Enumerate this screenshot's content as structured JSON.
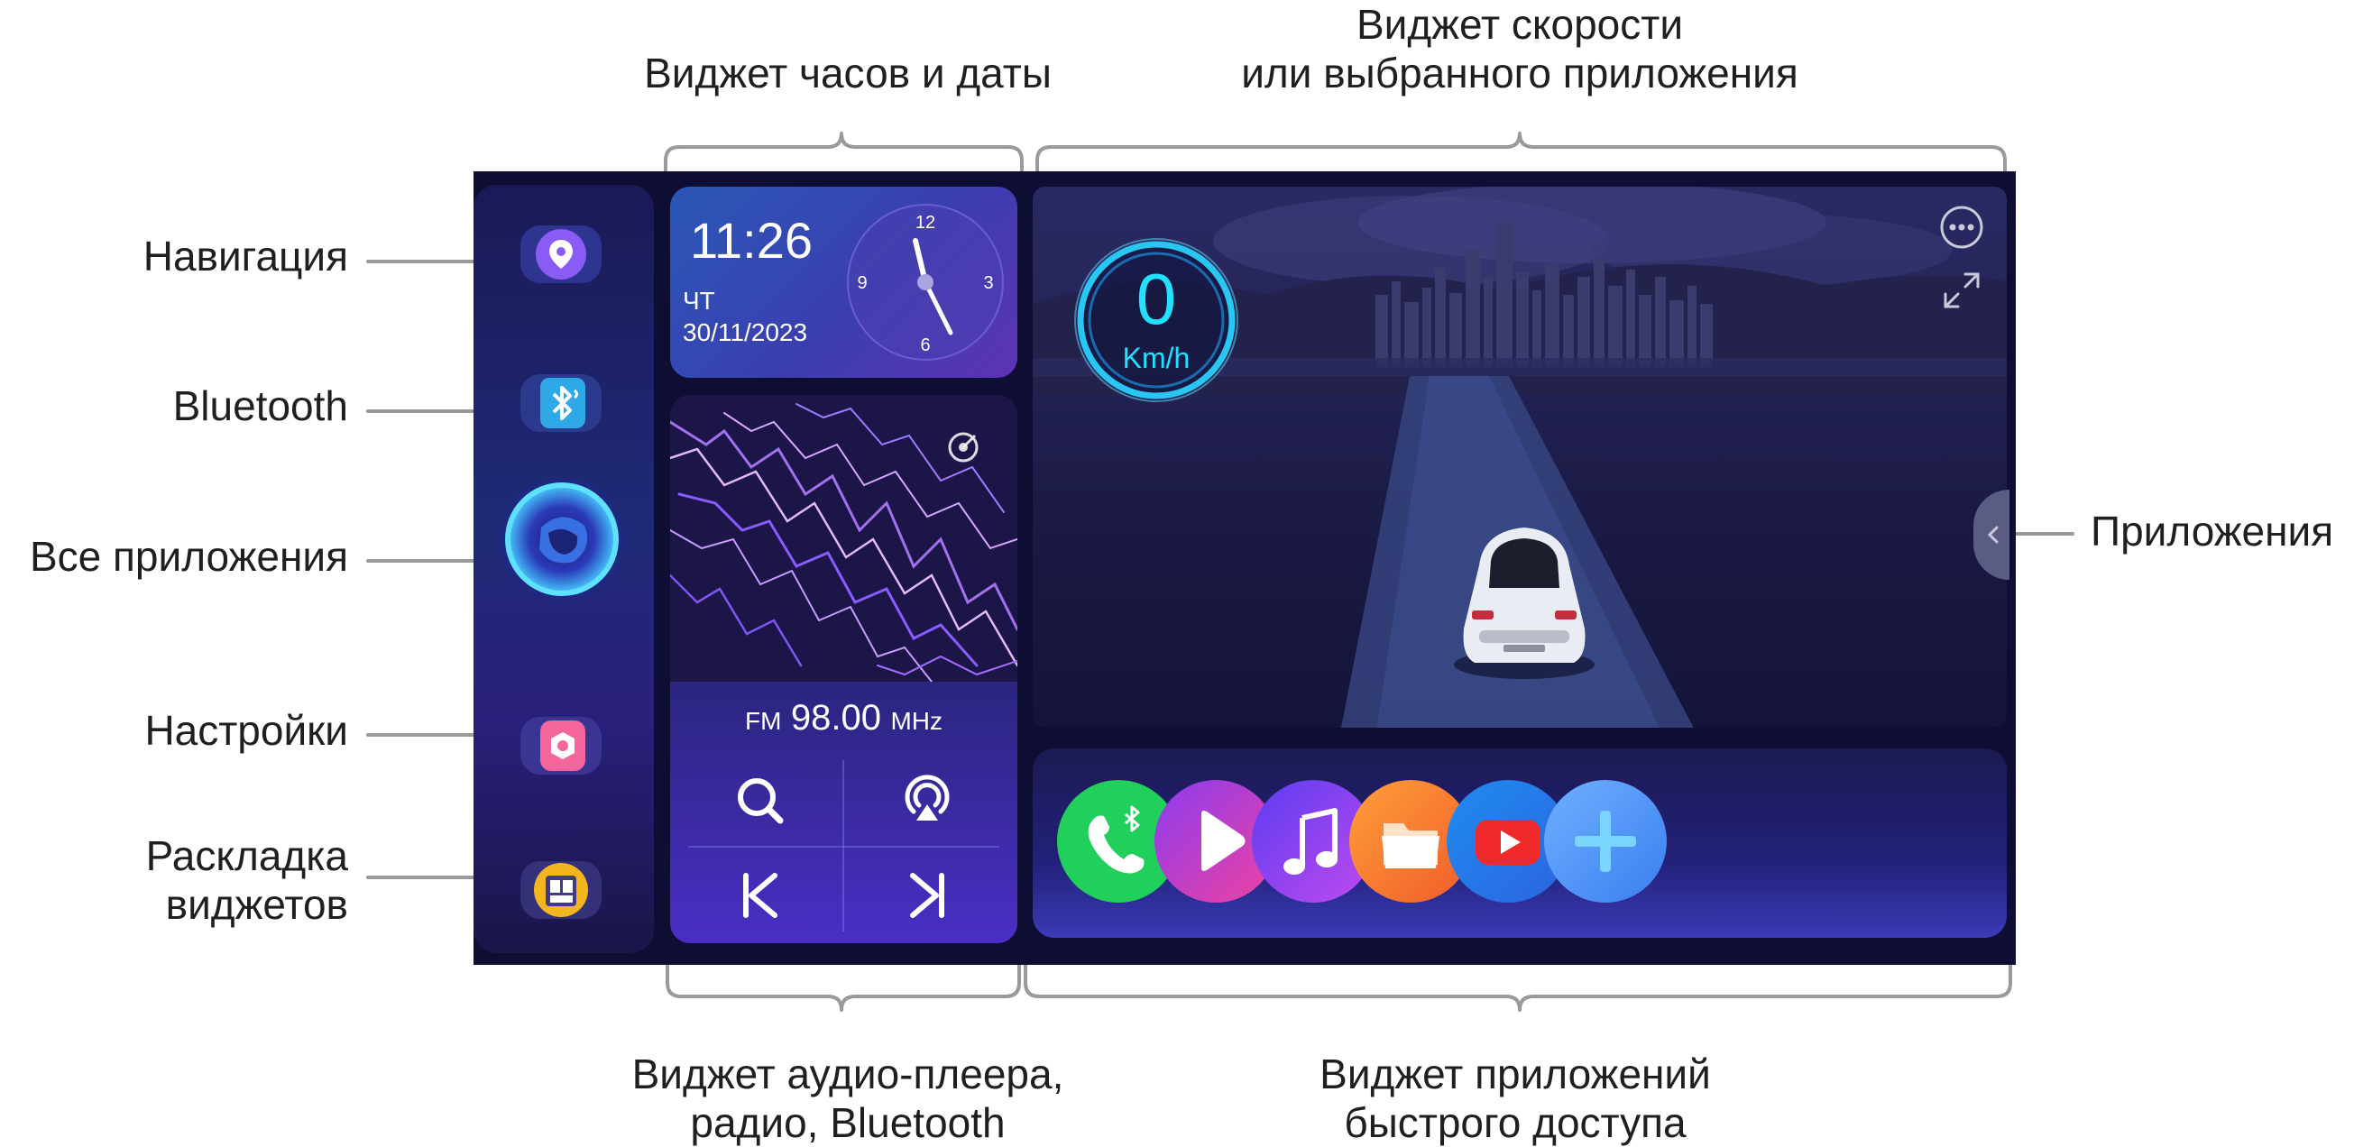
{
  "annotations": {
    "top_clock": "Виджет часов и даты",
    "top_speed": [
      "Виджет скорости",
      "или выбранного приложения"
    ],
    "left_nav": "Навигация",
    "left_bt": "Bluetooth",
    "left_all_apps": "Все приложения",
    "left_settings": "Настройки",
    "left_layout": [
      "Раскладка",
      "виджетов"
    ],
    "right_apps": "Приложения",
    "bottom_player": [
      "Виджет аудио-плеера,",
      "радио, Bluetooth"
    ],
    "bottom_quick": [
      "Виджет приложений",
      "быстрого доступа"
    ]
  },
  "clock": {
    "time": "11:26",
    "day": "ЧТ",
    "date": "30/11/2023",
    "dial": {
      "n12": "12",
      "n3": "3",
      "n6": "6",
      "n9": "9"
    }
  },
  "radio": {
    "band": "FM",
    "frequency": "98.00",
    "unit": "MHz"
  },
  "speed": {
    "value": "0",
    "unit": "Km/h"
  },
  "icons": {
    "sidebar": [
      "location-pin-icon",
      "bluetooth-icon",
      "all-apps-icon",
      "settings-icon",
      "widget-layout-icon"
    ],
    "radio": [
      "search-icon",
      "airplay-icon",
      "previous-icon",
      "next-icon",
      "radio-mode-icon"
    ],
    "speed": [
      "more-icon",
      "expand-icon"
    ],
    "apps": [
      "phone-bluetooth-icon",
      "video-player-icon",
      "music-icon",
      "files-icon",
      "youtube-icon",
      "add-icon"
    ]
  },
  "colors": {
    "speed_accent": "#22e0ff",
    "screen_bg": "#0e0d33"
  }
}
